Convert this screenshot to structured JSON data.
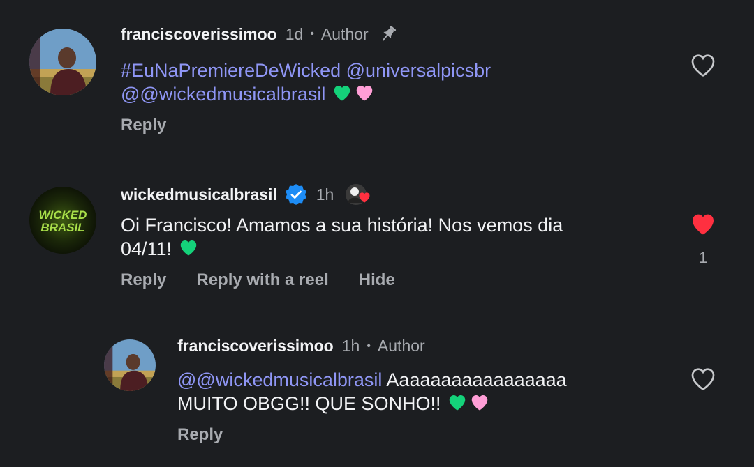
{
  "comments": [
    {
      "username": "franciscoverissimoo",
      "time": "1d",
      "role": "Author",
      "text_links": [
        "#EuNaPremiereDeWicked",
        "@universalpicsbr",
        "@wickedmusicalbrasil"
      ],
      "actions": [
        "Reply"
      ],
      "liked": false,
      "pinned": true
    },
    {
      "username": "wickedmusicalbrasil",
      "time": "1h",
      "verified": true,
      "avatar_text": [
        "WICKED",
        "BRASIL"
      ],
      "text_line1": "Oi Francisco! Amamos a sua história! Nos vemos dia",
      "text_line2": "04/11!",
      "actions": [
        "Reply",
        "Reply with a reel",
        "Hide"
      ],
      "liked": true,
      "like_count": "1"
    },
    {
      "username": "franciscoverissimoo",
      "time": "1h",
      "role": "Author",
      "mention": "@wickedmusicalbrasil",
      "text_rest": " Aaaaaaaaaaaaaaaaa",
      "text_line2": "MUITO OBGG!! QUE SONHO!!",
      "actions": [
        "Reply"
      ],
      "liked": false
    }
  ],
  "colors": {
    "background": "#1c1e21",
    "link": "#8f96f5",
    "like_red": "#ff3040",
    "verified_blue": "#1d8cf5",
    "green_heart": "#14d27a",
    "pink_heart": "#ff9ed6"
  }
}
